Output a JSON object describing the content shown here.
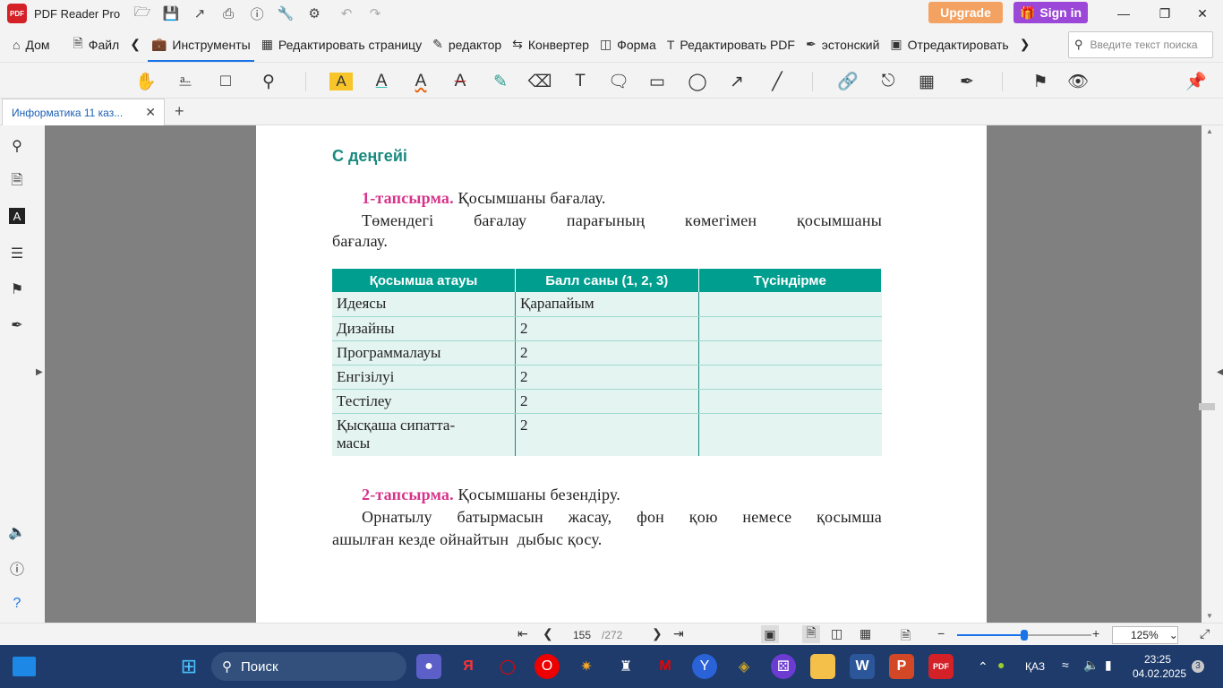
{
  "app": {
    "name": "PDF Reader Pro",
    "logo_text": "PDF"
  },
  "titlebar": {
    "upgrade": "Upgrade",
    "signin": "Sign in"
  },
  "menu": {
    "home": "Дом",
    "file": "Файл",
    "tools": "Инструменты",
    "edit_page": "Редактировать страницу",
    "editor": "редактор",
    "converter": "Конвертер",
    "form": "Форма",
    "edit_pdf": "Редактировать PDF",
    "estonian": "эстонский",
    "redact": "Отредактировать",
    "search_placeholder": "Введите текст поиска"
  },
  "tab": {
    "title": "Информатика 11 каз..."
  },
  "document": {
    "level_heading": "С деңгейі",
    "task1_label": "1-тапсырма.",
    "task1_title": " Қосымшаны бағалау.",
    "task1_line1": "Төмендегі бағалау парағының көмегімен қосымшаны",
    "task1_line2": "бағалау.",
    "table": {
      "headers": [
        "Қосымша атауы",
        "Балл саны (1, 2, 3)",
        "Түсіндірме"
      ],
      "rows": [
        {
          "name": "Идеясы",
          "score": "Қарапайым",
          "note": ""
        },
        {
          "name": "Дизайны",
          "score": "2",
          "note": ""
        },
        {
          "name": "Программалауы",
          "score": "2",
          "note": ""
        },
        {
          "name": "Енгізілуі",
          "score": "2",
          "note": ""
        },
        {
          "name": "Тестілеу",
          "score": "2",
          "note": ""
        },
        {
          "name": "Қысқаша сипатта-\nмасы",
          "score": "2",
          "note": ""
        }
      ]
    },
    "task2_label": "2-тапсырма.",
    "task2_title": " Қосымшаны безендіру.",
    "task2_line1": "Орнатылу батырмасын жасау, фон қою немесе қосымша",
    "task2_line2": "ашылған кезде ойнайтын  дыбыс қосу."
  },
  "status": {
    "page_current": "155",
    "page_total": "/272",
    "zoom": "125%",
    "zoom_fraction": 0.5
  },
  "taskbar": {
    "search": "Поиск",
    "language": "ҚАЗ",
    "time": "23:25",
    "date": "04.02.2025",
    "notifications": "3"
  },
  "colors": {
    "accent": "#1a73e8",
    "teal_header": "#009e8f",
    "task_label": "#d6338a",
    "level_heading": "#1a8a7f",
    "upgrade": "#f4a261",
    "signin": "#9b47d8"
  }
}
